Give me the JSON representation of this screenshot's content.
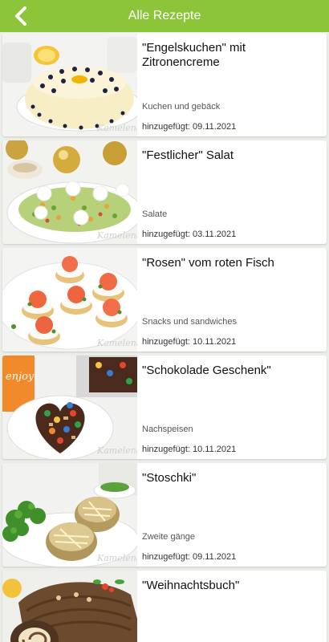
{
  "appbar": {
    "title": "Alle Rezepte",
    "back_icon": "chevron-left-icon",
    "color": "#8cc43a"
  },
  "recipes": [
    {
      "title": "\"Engelskuchen\" mit Zitronencreme",
      "category": "Kuchen und gebäck",
      "added": "hinzugefügt: 09.11.2021",
      "watermark": "Kamelena"
    },
    {
      "title": "\"Festlicher\" Salat",
      "category": "Salate",
      "added": "hinzugefügt: 03.11.2021",
      "watermark": "Kamelena"
    },
    {
      "title": "\"Rosen\" vom roten Fisch",
      "category": "Snacks und sandwiches",
      "added": "hinzugefügt: 10.11.2021",
      "watermark": "Kamelena"
    },
    {
      "title": "\"Schokolade Geschenk\"",
      "category": "Nachspeisen",
      "added": "hinzugefügt: 10.11.2021",
      "watermark": "Kamelena"
    },
    {
      "title": "\"Stoschki\"",
      "category": "Zweite gänge",
      "added": "hinzugefügt: 09.11.2021",
      "watermark": "Kamelena"
    },
    {
      "title": "\"Weihnachtsbuch\"",
      "category": "",
      "added": "",
      "watermark": ""
    }
  ],
  "photo_text": {
    "cup_label": "enjoy"
  }
}
